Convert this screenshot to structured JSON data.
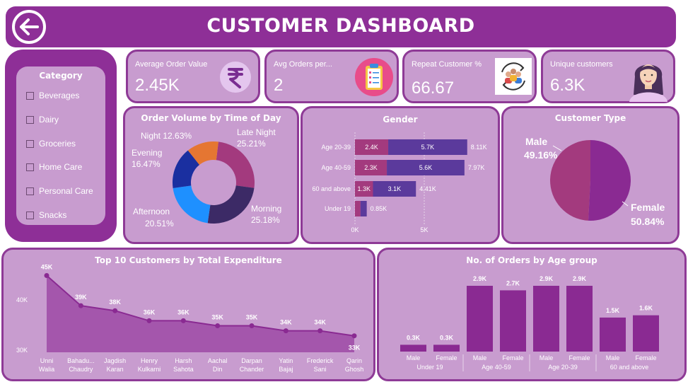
{
  "header": {
    "title": "CUSTOMER DASHBOARD"
  },
  "category": {
    "title": "Category",
    "items": [
      "Beverages",
      "Dairy",
      "Groceries",
      "Home Care",
      "Personal Care",
      "Snacks"
    ]
  },
  "kpis": [
    {
      "label": "Average Order Value",
      "value": "2.45K",
      "icon": "rupee-icon"
    },
    {
      "label": "Avg Orders per...",
      "value": "2",
      "icon": "clipboard-icon"
    },
    {
      "label": "Repeat Customer %",
      "value": "66.67",
      "icon": "repeat-customers-icon"
    },
    {
      "label": "Unique customers",
      "value": "6.3K",
      "icon": "woman-avatar-icon"
    }
  ],
  "colors": {
    "header": "#8e2f97",
    "panel": "#c89ccf",
    "border": "#8e3a96",
    "bar_purple": "#8a2a92",
    "female_bar": "#5b3a9c",
    "male_bar": "#a33a7e"
  },
  "chart_data": [
    {
      "type": "pie",
      "title": "Order Volume by Time of Day",
      "donut": true,
      "slices": [
        {
          "label": "Late Night",
          "value": 25.21,
          "display": "25.21%",
          "color": "#a33a7e"
        },
        {
          "label": "Morning",
          "value": 25.18,
          "display": "25.18%",
          "color": "#3c2a66"
        },
        {
          "label": "Afternoon",
          "value": 20.51,
          "display": "20.51%",
          "color": "#1e90ff"
        },
        {
          "label": "Evening",
          "value": 16.47,
          "display": "16.47%",
          "color": "#1a2fa0"
        },
        {
          "label": "Night",
          "value": 12.63,
          "display": "12.63%",
          "color": "#e57632"
        }
      ]
    },
    {
      "type": "bar",
      "orientation": "horizontal",
      "stacked": true,
      "title": "Gender",
      "categories": [
        "Age 20-39",
        "Age 40-59",
        "60 and above",
        "Under 19"
      ],
      "series": [
        {
          "name": "Male",
          "values": [
            2.4,
            2.3,
            1.3,
            0.4
          ],
          "labels": [
            "2.4K",
            "2.3K",
            "1.3K",
            ""
          ]
        },
        {
          "name": "Female",
          "values": [
            5.7,
            5.6,
            3.1,
            0.45
          ],
          "labels": [
            "5.7K",
            "5.6K",
            "3.1K",
            ""
          ]
        }
      ],
      "totals": [
        "8.11K",
        "7.97K",
        "4.41K",
        "0.85K"
      ],
      "x_ticks": [
        "0K",
        "5K"
      ],
      "xlim": [
        0,
        10
      ]
    },
    {
      "type": "pie",
      "title": "Customer Type",
      "slices": [
        {
          "label": "Male",
          "value": 49.16,
          "display": "49.16%",
          "color": "#a33a7e"
        },
        {
          "label": "Female",
          "value": 50.84,
          "display": "50.84%",
          "color": "#8a2a92"
        }
      ]
    },
    {
      "type": "area",
      "title": "Top 10 Customers by Total Expenditure",
      "categories": [
        [
          "Unni",
          "Walia"
        ],
        [
          "Bahadu...",
          "Chaudry"
        ],
        [
          "Jagdish",
          "Karan"
        ],
        [
          "Henry",
          "Kulkarni"
        ],
        [
          "Harsh",
          "Sahota"
        ],
        [
          "Aachal",
          "Din"
        ],
        [
          "Darpan",
          "Chander"
        ],
        [
          "Yatin",
          "Bajaj"
        ],
        [
          "Frederick",
          "Sani"
        ],
        [
          "Qarin",
          "Ghosh"
        ]
      ],
      "values": [
        45,
        39,
        38,
        36,
        36,
        35,
        35,
        34,
        34,
        33
      ],
      "labels": [
        "45K",
        "39K",
        "38K",
        "36K",
        "36K",
        "35K",
        "35K",
        "34K",
        "34K",
        "33K"
      ],
      "y_ticks": [
        "40K",
        "30K"
      ],
      "ylim": [
        30,
        46
      ]
    },
    {
      "type": "bar",
      "title": "No. of Orders by Age group",
      "groups": [
        "Under 19",
        "Age 40-59",
        "Age 20-39",
        "60 and above"
      ],
      "bars": [
        {
          "group": 0,
          "label": "Male",
          "value": 0.3,
          "display": "0.3K"
        },
        {
          "group": 0,
          "label": "Female",
          "value": 0.3,
          "display": "0.3K"
        },
        {
          "group": 1,
          "label": "Male",
          "value": 2.9,
          "display": "2.9K"
        },
        {
          "group": 1,
          "label": "Female",
          "value": 2.7,
          "display": "2.7K"
        },
        {
          "group": 2,
          "label": "Male",
          "value": 2.9,
          "display": "2.9K"
        },
        {
          "group": 2,
          "label": "Female",
          "value": 2.9,
          "display": "2.9K"
        },
        {
          "group": 3,
          "label": "Male",
          "value": 1.5,
          "display": "1.5K"
        },
        {
          "group": 3,
          "label": "Female",
          "value": 1.6,
          "display": "1.6K"
        }
      ],
      "ylim": [
        0,
        3.1
      ]
    }
  ]
}
